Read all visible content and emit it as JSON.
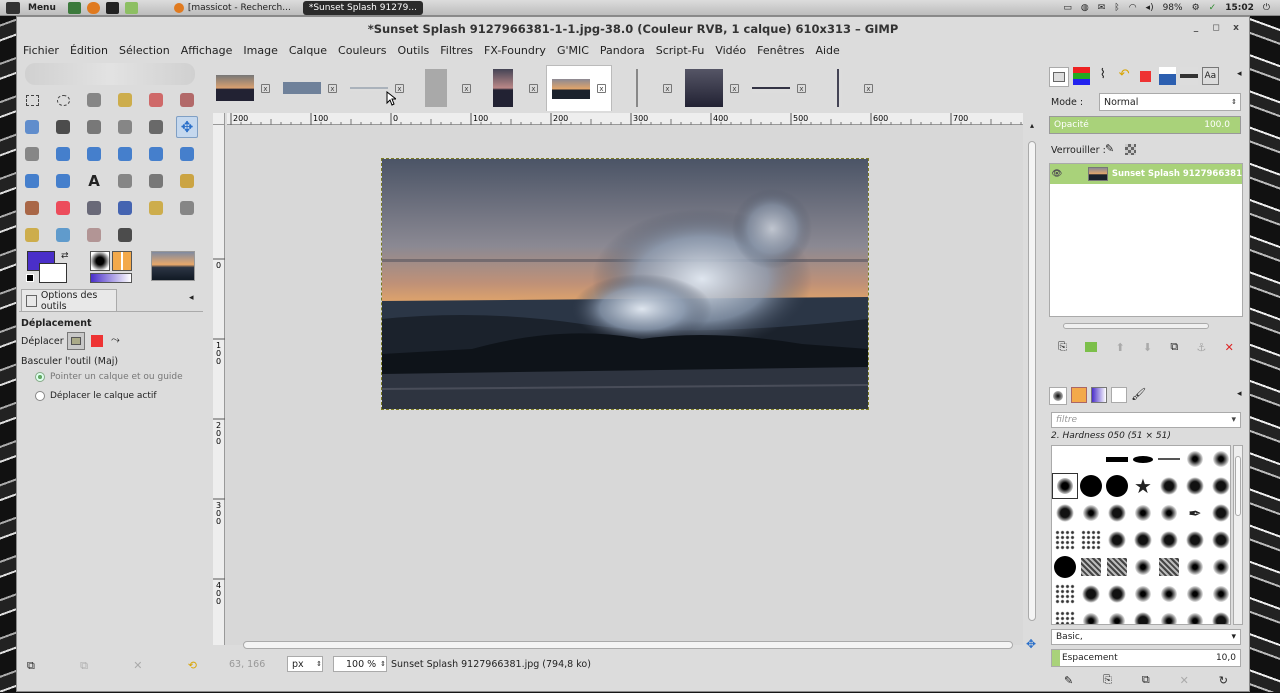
{
  "panel": {
    "menu_label": "Menu",
    "tasks": [
      {
        "label": "[massicot - Recherch...",
        "active": false
      },
      {
        "label": "*Sunset Splash 91279...",
        "active": true
      }
    ],
    "battery": "98%",
    "clock": "15:02"
  },
  "window": {
    "title": "*Sunset Splash 9127966381-1-1.jpg-38.0 (Couleur RVB, 1 calque) 610x313 – GIMP",
    "controls": [
      "_",
      "◻",
      "x"
    ]
  },
  "menubar": [
    "Fichier",
    "Édition",
    "Sélection",
    "Affichage",
    "Image",
    "Calque",
    "Couleurs",
    "Outils",
    "Filtres",
    "FX-Foundry",
    "G'MIC",
    "Pandora",
    "Script-Fu",
    "Vidéo",
    "Fenêtres",
    "Aide"
  ],
  "toolbox": {
    "options_tab": "Options des outils",
    "tool_name": "Déplacement",
    "move_label": "Déplacer :",
    "toggle_label": "Basculer l'outil  (Maj)",
    "radio_pick": "Pointer un calque et ou guide",
    "radio_active": "Déplacer le calque actif",
    "fg_color": "#4a2fc9",
    "bg_color": "#ffffff"
  },
  "rulers": {
    "h_ticks": [
      "200",
      "100",
      "0",
      "100",
      "200",
      "300",
      "400",
      "500",
      "600",
      "700"
    ],
    "v_ticks": [
      "0",
      "1 0 0",
      "2 0 0",
      "3 0 0",
      "4 0 0"
    ]
  },
  "status": {
    "coords": "63, 166",
    "unit": "px",
    "zoom": "100 %",
    "file_info": "Sunset Splash 9127966381.jpg (794,8 ko)"
  },
  "layers": {
    "mode_label": "Mode :",
    "mode_value": "Normal",
    "opacity_label": "Opacité",
    "opacity_value": "100.0",
    "lock_label": "Verrouiller :",
    "layer_name": "Sunset Splash 9127966381"
  },
  "brushes": {
    "filter_placeholder": "filtre",
    "selected_brush": "2. Hardness 050 (51 × 51)",
    "preset": "Basic,",
    "spacing_label": "Espacement",
    "spacing_value": "10,0"
  },
  "colors": {
    "accent_green": "#a9d27a",
    "selected_layer": "#a9d27a"
  }
}
